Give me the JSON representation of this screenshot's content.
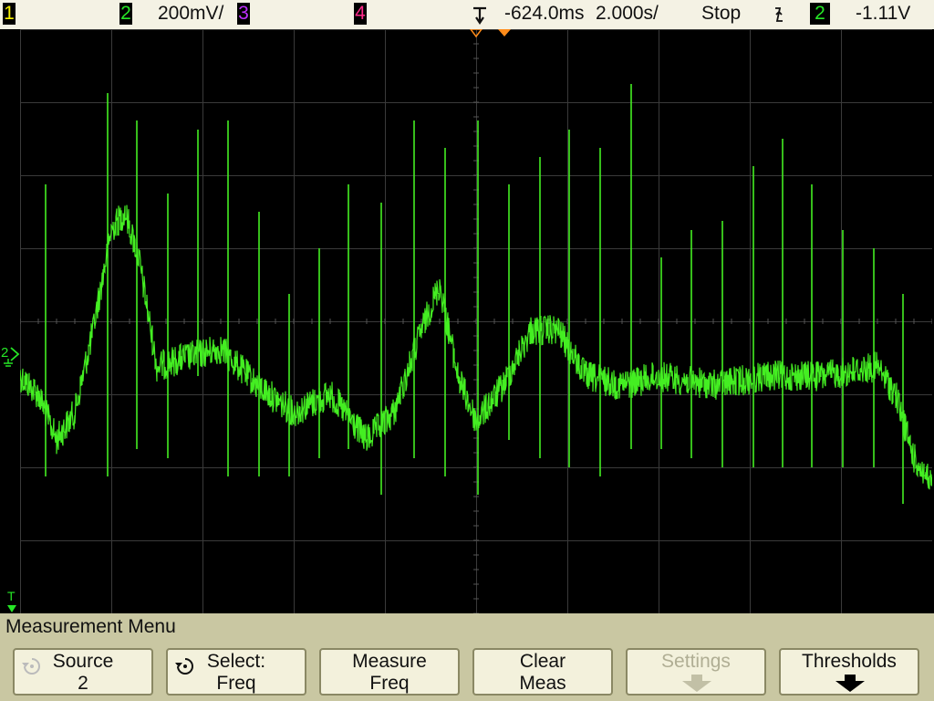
{
  "status_bar": {
    "channels": [
      {
        "label": "1",
        "color": "#f6f000"
      },
      {
        "label": "2",
        "color": "#26e626"
      },
      {
        "label": "3",
        "color": "#c030ff"
      },
      {
        "label": "4",
        "color": "#ff2a8a"
      }
    ],
    "volts_per_div": "200mV/",
    "time_delay": "-624.0ms",
    "time_per_div": "2.000s/",
    "run_state": "Stop",
    "trigger_source": "2",
    "trigger_level": "-1.11V"
  },
  "screen": {
    "ground_marker_label": "2",
    "trigger_marker_label": "T",
    "trace_color": "#44ee22"
  },
  "menu": {
    "title": "Measurement Menu",
    "softkeys": [
      {
        "line1": "Source",
        "line2": "2",
        "icon": "knob-icon"
      },
      {
        "line1": "Select:",
        "line2": "Freq",
        "icon": "knob-icon"
      },
      {
        "line1": "Measure",
        "line2": "Freq"
      },
      {
        "line1": "Clear",
        "line2": "Meas"
      },
      {
        "line1": "Settings",
        "line2": "",
        "icon": "down-arrow-icon",
        "disabled": true
      },
      {
        "line1": "Thresholds",
        "line2": "",
        "icon": "down-arrow-icon"
      }
    ]
  }
}
